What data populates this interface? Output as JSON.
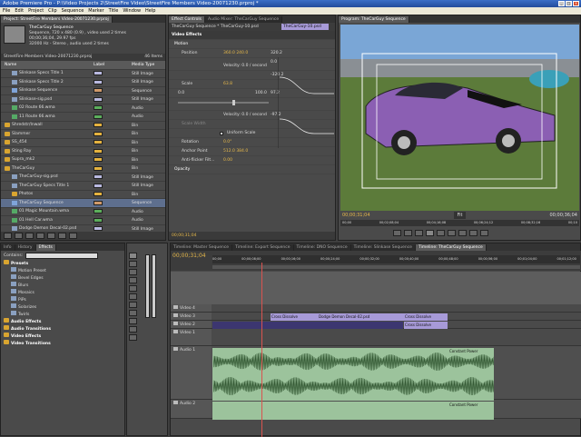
{
  "window": {
    "title": "Adobe Premiere Pro - P:\\Video Projects 2\\StreetFire Video\\StreetFire Members Video-20071230.prproj *"
  },
  "menu": [
    "File",
    "Edit",
    "Project",
    "Clip",
    "Sequence",
    "Marker",
    "Title",
    "Window",
    "Help"
  ],
  "project": {
    "tab": "Project: StreetFire Members Video-20071230.prproj",
    "sequence_name": "TheCarGuy Sequence",
    "info_lines": [
      "Sequence, 720 x 480 (0.9) , video used 2 times",
      "00;00;36;04, 29.97 fps",
      "32000 Hz - Stereo , audio used 2 times"
    ],
    "bin_path": "StreetFire Members Video-20071230.prproj",
    "item_count": "46 Items",
    "columns": [
      "Name",
      "Label",
      "Media Type"
    ],
    "items": [
      {
        "name": "Slinkase Specs Title 1",
        "type": "Still Image",
        "label": "#b9b9e0",
        "icon": "still",
        "indent": 1
      },
      {
        "name": "Slinkase Specs Title 2",
        "type": "Still Image",
        "label": "#b9b9e0",
        "icon": "still",
        "indent": 1
      },
      {
        "name": "Slinkase Sequence",
        "type": "Sequence",
        "label": "#d09a6a",
        "icon": "seq",
        "indent": 1
      },
      {
        "name": "Slinkase-sig.psd",
        "type": "Still Image",
        "label": "#b9b9e0",
        "icon": "still",
        "indent": 1
      },
      {
        "name": "02 Route 66.wma",
        "type": "Audio",
        "label": "#5cae5c",
        "icon": "audio",
        "indent": 1
      },
      {
        "name": "11 Route 66.wma",
        "type": "Audio",
        "label": "#5cae5c",
        "icon": "audio",
        "indent": 1
      },
      {
        "name": "Shredstr/Inwall",
        "type": "Bin",
        "label": "#e4b23f",
        "icon": "bin",
        "indent": 0
      },
      {
        "name": "Slammer",
        "type": "Bin",
        "label": "#e4b23f",
        "icon": "bin",
        "indent": 0
      },
      {
        "name": "SS_454",
        "type": "Bin",
        "label": "#e4b23f",
        "icon": "bin",
        "indent": 0
      },
      {
        "name": "Sting Ray",
        "type": "Bin",
        "label": "#e4b23f",
        "icon": "bin",
        "indent": 0
      },
      {
        "name": "Supra_mk2",
        "type": "Bin",
        "label": "#e4b23f",
        "icon": "bin",
        "indent": 0
      },
      {
        "name": "TheCarGuy",
        "type": "Bin",
        "label": "#e4b23f",
        "icon": "bin",
        "indent": 0
      },
      {
        "name": "TheCarGuy-sig.psd",
        "type": "Still Image",
        "label": "#b9b9e0",
        "icon": "still",
        "indent": 1
      },
      {
        "name": "TheCarGuy Specs Title 1",
        "type": "Still Image",
        "label": "#b9b9e0",
        "icon": "still",
        "indent": 1
      },
      {
        "name": "Photos",
        "type": "Bin",
        "label": "#e4b23f",
        "icon": "bin",
        "indent": 1
      },
      {
        "name": "TheCarGuy Sequence",
        "type": "Sequence",
        "label": "#d09a6a",
        "icon": "seq",
        "indent": 1,
        "selected": true
      },
      {
        "name": "01 Magic Mountain.wma",
        "type": "Audio",
        "label": "#5cae5c",
        "icon": "audio",
        "indent": 1
      },
      {
        "name": "01 Hell Car.wma",
        "type": "Audio",
        "label": "#5cae5c",
        "icon": "audio",
        "indent": 1
      },
      {
        "name": "Dodge Demon Decal-02.psd",
        "type": "Still Image",
        "label": "#b9b9e0",
        "icon": "still",
        "indent": 1
      },
      {
        "name": "TheCarGuy Specs Title 2",
        "type": "Still Image",
        "label": "#b9b9e0",
        "icon": "still",
        "indent": 1
      }
    ]
  },
  "effect_controls": {
    "tabs": [
      "Effect Controls",
      "Audio Mixer: TheCarGuy Sequence"
    ],
    "clip_path": "TheCarGuy Sequence * TheCarGuy-10.psd",
    "clip_label": "TheCarGuy-10.psd",
    "section": "Video Effects",
    "motion": "Motion",
    "position_label": "Position",
    "position_value": "360.0   240.0",
    "velocity1": "Velocity: 0.0 / second",
    "scale_label": "Scale",
    "scale_value": "63.8",
    "scale_min": "0.0",
    "scale_max": "100.0",
    "graph_top": "320.2",
    "graph_mid": "0.0",
    "graph_bot": "-320.2",
    "graph2_top": "97.2",
    "graph2_bot": "-97.2",
    "velocity2": "Velocity: 0.0 / second",
    "scale_width": "Scale Width",
    "uniform_scale": "Uniform Scale",
    "rotation_label": "Rotation",
    "rotation_value": "0.0°",
    "anchor_label": "Anchor Point",
    "anchor_value": "512.0   384.0",
    "antiflicker_label": "Anti-flicker Filt...",
    "antiflicker_value": "0.00",
    "opacity": "Opacity",
    "timecode": "00;00;31;04"
  },
  "program": {
    "tab": "Program: TheCarGuy Sequence",
    "timecode_left": "00;00;31;04",
    "timecode_right": "00;00;36;04",
    "fit": "Fit",
    "ruler": [
      "00;00",
      "00;02;08;04",
      "00;04;16;08",
      "00;06;24;12",
      "00;08;32;16",
      "00;10"
    ]
  },
  "effects": {
    "tabs": [
      "Info",
      "History",
      "Effects"
    ],
    "contains": "Contains:",
    "items": [
      {
        "label": "Presets",
        "level": 0,
        "kind": "folder"
      },
      {
        "label": "Motion Preset",
        "level": 1,
        "kind": "preset"
      },
      {
        "label": "Bevel Edges",
        "level": 1,
        "kind": "preset"
      },
      {
        "label": "Blurs",
        "level": 1,
        "kind": "preset"
      },
      {
        "label": "Mosaics",
        "level": 1,
        "kind": "preset"
      },
      {
        "label": "PiPs",
        "level": 1,
        "kind": "preset"
      },
      {
        "label": "Solarizes",
        "level": 1,
        "kind": "preset"
      },
      {
        "label": "Twirls",
        "level": 1,
        "kind": "preset"
      },
      {
        "label": "Audio Effects",
        "level": 0,
        "kind": "folder"
      },
      {
        "label": "Audio Transitions",
        "level": 0,
        "kind": "folder"
      },
      {
        "label": "Video Effects",
        "level": 0,
        "kind": "folder"
      },
      {
        "label": "Video Transitions",
        "level": 0,
        "kind": "folder"
      }
    ]
  },
  "timeline": {
    "tabs": [
      "Timeline: Master Sequence",
      "Timeline: Export Sequence",
      "Timeline: DNO Sequence",
      "Timeline: Slinkase Sequence",
      "Timeline: TheCarGuy Sequence"
    ],
    "timecode": "00;00;31;04",
    "ruler": [
      "00;00",
      "00;00;08;00",
      "00;00;16;00",
      "00;00;24;00",
      "00;00;32;00",
      "00;00;40;00",
      "00;00;48;00",
      "00;00;56;00",
      "00;01;04;00",
      "00;01;12;00"
    ],
    "tracks": [
      {
        "name": "Video 4",
        "kind": "video"
      },
      {
        "name": "Video 3",
        "kind": "video"
      },
      {
        "name": "Video 2",
        "kind": "video"
      },
      {
        "name": "Video 1",
        "kind": "video"
      },
      {
        "name": "Audio 1",
        "kind": "audio"
      },
      {
        "name": "Audio 2",
        "kind": "audio"
      }
    ],
    "clips": {
      "v3_cross1": "Cross Dissolve",
      "v3_decal": "Dodge Demon Decal-02.psd",
      "v3_cross2": "Cross Dissolve",
      "v2_cross": "Cross Dissolve",
      "a1_power": "Constant Power",
      "a2_power": "Constant Power"
    }
  },
  "colors": {
    "clip_video": "#a79ad8",
    "clip_audio": "#9cc39c",
    "accent": "#e6b84a",
    "playhead": "#d9534f"
  }
}
